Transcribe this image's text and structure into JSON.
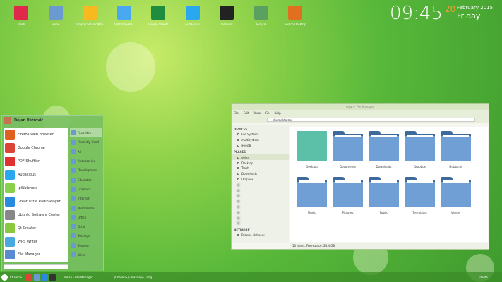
{
  "desktop": {
    "icons": [
      {
        "label": "Trash",
        "color": "#e0284a"
      },
      {
        "label": "Home",
        "color": "#6a9ad0"
      },
      {
        "label": "Graphical Disk Map",
        "color": "#f8b820"
      },
      {
        "label": "Sqlitebrowser",
        "color": "#4aa8f0"
      },
      {
        "label": "Google Sheets",
        "color": "#1e8e3e"
      },
      {
        "label": "Audacious",
        "color": "#29a8f0"
      },
      {
        "label": "Terminal",
        "color": "#222222"
      },
      {
        "label": "Recycle",
        "color": "#5aa060"
      },
      {
        "label": "Switch Desktop",
        "color": "#e07020"
      }
    ]
  },
  "clock": {
    "time": "09:45",
    "day": "20",
    "month_year": "February 2015",
    "weekday": "Friday"
  },
  "menu": {
    "user": "Dejan Petrović",
    "apps": [
      {
        "label": "Firefox Web Browser",
        "color": "#e06020"
      },
      {
        "label": "Google Chrome",
        "color": "#db4437"
      },
      {
        "label": "PDF-Shuffler",
        "color": "#e03030"
      },
      {
        "label": "Audacious",
        "color": "#29a8f0"
      },
      {
        "label": "IpWatchers",
        "color": "#8ad04a"
      },
      {
        "label": "Great Little Radio Player",
        "color": "#2a8ae0"
      },
      {
        "label": "Ubuntu Software Center",
        "color": "#888888"
      },
      {
        "label": "Qt Creator",
        "color": "#8ac840"
      },
      {
        "label": "WPS Writer",
        "color": "#4aa8e0"
      },
      {
        "label": "File Manager",
        "color": "#5a8ad0"
      }
    ],
    "categories": [
      "Favorites",
      "Recently Used",
      "All",
      "Accessories",
      "Development",
      "Education",
      "Graphics",
      "Internet",
      "Multimedia",
      "Office",
      "Other",
      "Settings",
      "System",
      "Wine"
    ],
    "search_placeholder": ""
  },
  "filemanager": {
    "title": "dejan - File Manager",
    "menu": [
      "File",
      "Edit",
      "View",
      "Go",
      "Help"
    ],
    "location": "/home/dejan/",
    "devices_header": "DEVICES",
    "devices": [
      "File System",
      "multisystem",
      "900GB"
    ],
    "places_header": "PLACES",
    "places": [
      "dejan",
      "Desktop",
      "Trash",
      "Downloads",
      "Dropbox"
    ],
    "network_header": "NETWORK",
    "network": [
      "Browse Network"
    ],
    "items": [
      "Desktop",
      "Documents",
      "Downloads",
      "Dropbox",
      "Hubband",
      "Music",
      "Pictures",
      "Public",
      "Templates",
      "Videos"
    ],
    "status": "10 items, Free space: 24.4 GB"
  },
  "panel": {
    "start": "ChaleOS",
    "tasks": [
      "dejan - File Manager",
      "[ChaleOS] - Inkscape - Img..."
    ],
    "time": "09:45"
  }
}
